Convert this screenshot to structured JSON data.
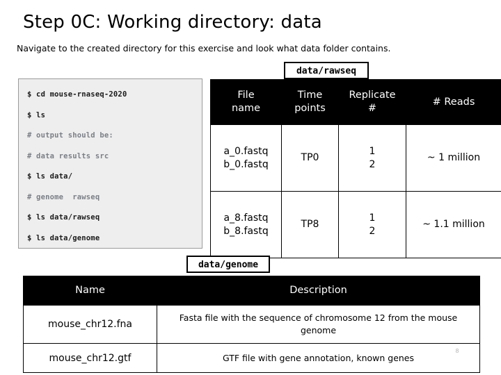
{
  "slide": {
    "title": "Step 0C: Working directory: data",
    "subtitle": "Navigate to the created directory for this exercise and look what data folder contains.",
    "number": "8"
  },
  "terminal": {
    "lines": [
      {
        "kind": "command",
        "text": "$ cd mouse-rnaseq-2020"
      },
      {
        "kind": "command",
        "text": "$ ls"
      },
      {
        "kind": "comment",
        "text": "# output should be:"
      },
      {
        "kind": "comment",
        "text": "# data results src"
      },
      {
        "kind": "command",
        "text": "$ ls data/"
      },
      {
        "kind": "comment",
        "text": "# genome  rawseq"
      },
      {
        "kind": "command",
        "text": "$ ls data/rawseq"
      },
      {
        "kind": "command",
        "text": "$ ls data/genome"
      }
    ]
  },
  "rawseq_table": {
    "caption": "data/rawseq",
    "headers": [
      "File name",
      "Time points",
      "Replicate #",
      "# Reads"
    ],
    "headers_stacked": [
      [
        "File",
        "name"
      ],
      [
        "Time",
        "points"
      ],
      [
        "Replicate",
        "#"
      ],
      [
        "# Reads"
      ]
    ],
    "rows": [
      {
        "file_name": [
          "a_0.fastq",
          "b_0.fastq"
        ],
        "time_point": "TP0",
        "replicate": [
          "1",
          "2"
        ],
        "reads": "~ 1 million"
      },
      {
        "file_name": [
          "a_8.fastq",
          "b_8.fastq"
        ],
        "time_point": "TP8",
        "replicate": [
          "1",
          "2"
        ],
        "reads": "~ 1.1 million"
      }
    ]
  },
  "genome_table": {
    "caption": "data/genome",
    "headers": [
      "Name",
      "Description"
    ],
    "rows": [
      {
        "name": "mouse_chr12.fna",
        "description": "Fasta file with the sequence of chromosome 12 from the mouse genome"
      },
      {
        "name": "mouse_chr12.gtf",
        "description": "GTF file with gene annotation, known genes"
      }
    ]
  },
  "colors": {
    "header_bg": "#000000",
    "header_text": "#ffffff",
    "code_bg": "#eeeeee",
    "code_border": "#9a9a9a",
    "comment_text": "#7b7f86",
    "command_text": "#1a1a1a",
    "slide_number": "#b5b5b5"
  }
}
